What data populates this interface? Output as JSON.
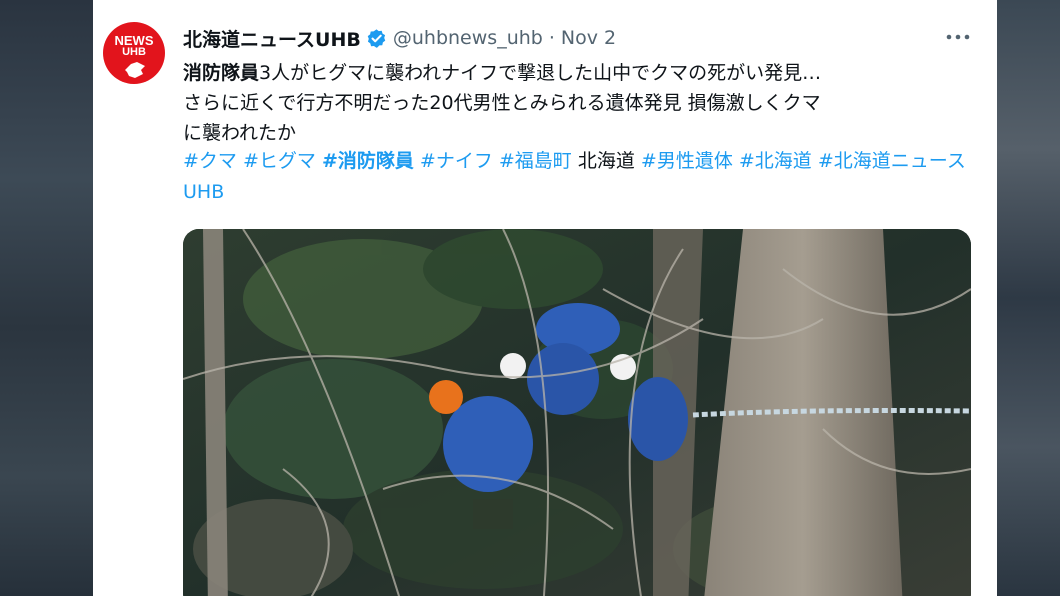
{
  "tweet": {
    "display_name": "北海道ニュースUHB",
    "handle": "@uhbnews_uhb",
    "separator": "·",
    "date": "Nov 2",
    "more_label": "•••",
    "text_bold": "消防隊員",
    "text_line1_rest": "3人がヒグマに襲われナイフで撃退した山中でクマの死がい発見…",
    "text_line2": "さらに近くで行方不明だった20代男性とみられる遺体発見 損傷激しくクマ",
    "text_line3": "に襲われたか",
    "hashtags": [
      {
        "text": "#クマ",
        "type": "tag"
      },
      {
        "text": "#ヒグマ",
        "type": "tag"
      },
      {
        "text": "#消防隊員",
        "type": "tag-bold"
      },
      {
        "text": "#ナイフ",
        "type": "tag"
      },
      {
        "text": "#福島町",
        "type": "tag"
      },
      {
        "text": "北海道",
        "type": "plain"
      },
      {
        "text": "#男性遺体",
        "type": "tag"
      },
      {
        "text": "#北海道",
        "type": "tag"
      },
      {
        "text": "#北海道ニュースUHB",
        "type": "tag"
      }
    ]
  },
  "avatar": {
    "word": "NEWS",
    "sub": "UHB"
  },
  "colors": {
    "link": "#1d9bf0",
    "brand_red": "#e2141c",
    "verified": "#1d9bf0",
    "uniform": "#2f5fb8"
  },
  "icons": {
    "verified": "verified-badge-icon",
    "more": "more-options-icon"
  }
}
